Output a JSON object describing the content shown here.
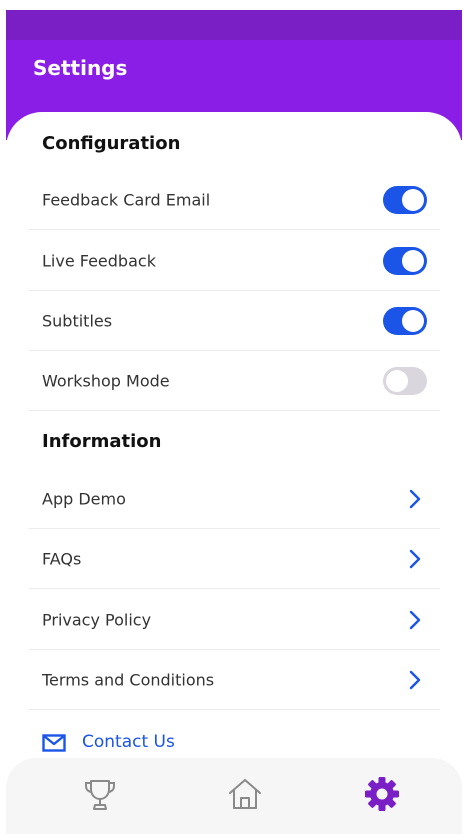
{
  "header": {
    "title": "Settings"
  },
  "configuration": {
    "title": "Configuration",
    "items": [
      {
        "label": "Feedback Card Email",
        "enabled": true
      },
      {
        "label": "Live Feedback",
        "enabled": true
      },
      {
        "label": "Subtitles",
        "enabled": true
      },
      {
        "label": "Workshop Mode",
        "enabled": false
      }
    ]
  },
  "information": {
    "title": "Information",
    "items": [
      {
        "label": "App Demo"
      },
      {
        "label": "FAQs"
      },
      {
        "label": "Privacy Policy"
      },
      {
        "label": "Terms and Conditions"
      }
    ]
  },
  "contact": {
    "label": "Contact Us",
    "icon": "mail-icon"
  },
  "nav": {
    "items": [
      {
        "icon": "trophy-icon",
        "active": false
      },
      {
        "icon": "home-icon",
        "active": false
      },
      {
        "icon": "gear-icon",
        "active": true
      }
    ]
  },
  "colors": {
    "header": "#8b1ee6",
    "status_bar": "#7a1fc6",
    "accent": "#1a55e8",
    "toggle_off": "#d9d6dd",
    "nav_active": "#7a1fc6",
    "nav_inactive": "#8a8a8a"
  }
}
